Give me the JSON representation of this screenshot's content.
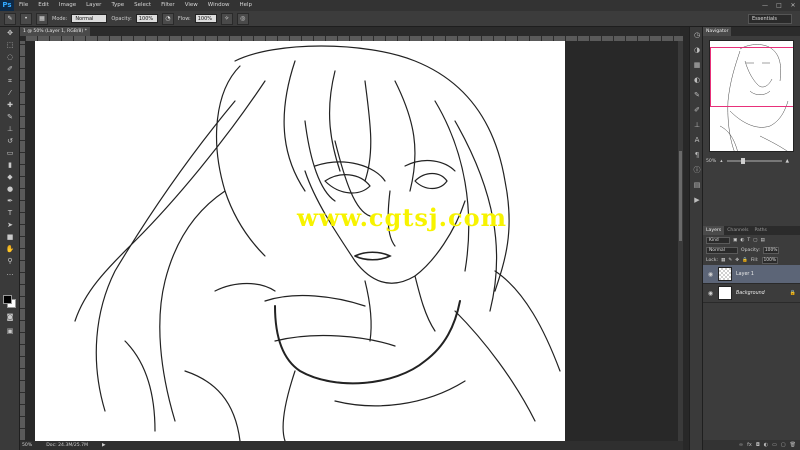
{
  "app": {
    "logo": "Ps",
    "menu": [
      "File",
      "Edit",
      "Image",
      "Layer",
      "Type",
      "Select",
      "Filter",
      "View",
      "Window",
      "Help"
    ],
    "window_controls": [
      "—",
      "□",
      "✕"
    ]
  },
  "options_bar": {
    "mode_label": "Mode:",
    "mode_value": "Normal",
    "opacity_label": "Opacity:",
    "opacity_value": "100%",
    "flow_label": "Flow:",
    "flow_value": "100%",
    "workspace": "Essentials"
  },
  "document": {
    "tab_title": "1 @ 50% (Layer 1, RGB/8) *",
    "zoom": "50%",
    "doc_size": "Doc: 24.3M/25.7M"
  },
  "canvas": {
    "watermark": "www.cgtsj.com"
  },
  "navigator": {
    "tab_label": "Navigator",
    "zoom": "50%"
  },
  "layers_panel": {
    "tabs": [
      "Layers",
      "Channels",
      "Paths"
    ],
    "kind_filter": "Kind",
    "blend_mode": "Normal",
    "opacity_label": "Opacity:",
    "opacity_value": "100%",
    "lock_label": "Lock:",
    "fill_label": "Fill:",
    "fill_value": "100%",
    "layers": [
      {
        "name": "Layer 1",
        "selected": true,
        "transparent": true
      },
      {
        "name": "Background",
        "selected": false,
        "transparent": false
      }
    ]
  },
  "colors": {
    "accent_navigator": "#e8307a",
    "watermark": "#f7f300",
    "selected_layer": "#5c6577"
  }
}
